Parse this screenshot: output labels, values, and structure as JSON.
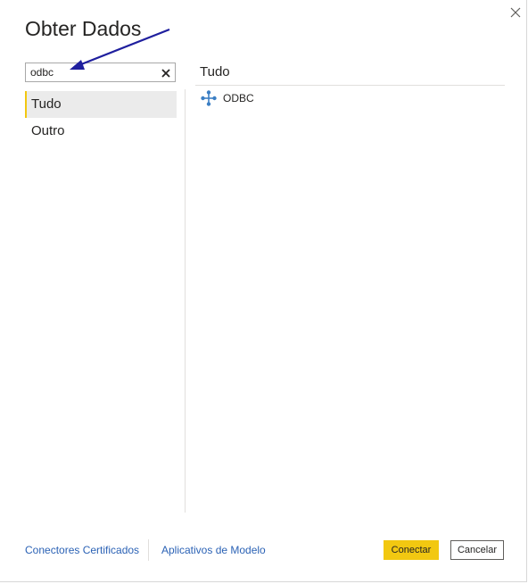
{
  "dialog": {
    "title": "Obter Dados",
    "close_icon": "close-icon"
  },
  "search": {
    "value": "odbc",
    "placeholder": "",
    "clear_icon": "clear-x-icon"
  },
  "nav": {
    "items": [
      {
        "label": "Tudo",
        "selected": true
      },
      {
        "label": "Outro",
        "selected": false
      }
    ]
  },
  "main": {
    "section_title": "Tudo",
    "connectors": [
      {
        "label": "ODBC",
        "icon": "odbc-connector-icon"
      }
    ]
  },
  "footer": {
    "certified_link": "Conectores Certificados",
    "templates_link": "Aplicativos de Modelo",
    "connect_label": "Conectar",
    "cancel_label": "Cancelar"
  },
  "colors": {
    "accent_yellow": "#f2c811",
    "link_blue": "#2b62b5",
    "annotation_arrow": "#1f1f9e",
    "icon_blue": "#3c7fc4"
  }
}
